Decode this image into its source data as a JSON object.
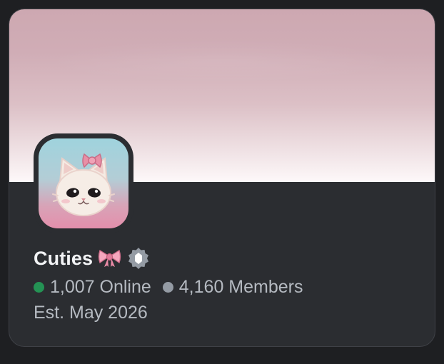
{
  "server": {
    "name": "Cuties",
    "name_emoji": "ribbon-bow",
    "badge_icon": "discoverable-badge-icon",
    "online_text": "1,007 Online",
    "members_text": "4,160 Members",
    "established_text": "Est. May 2026"
  },
  "colors": {
    "online_dot": "#23a55a",
    "members_dot": "#949ba4",
    "card_background": "#2b2d31",
    "banner_top": "#cda8b1",
    "banner_bottom": "#fdf8f9"
  },
  "avatar": {
    "icon": "white-cat-with-pink-bow"
  }
}
